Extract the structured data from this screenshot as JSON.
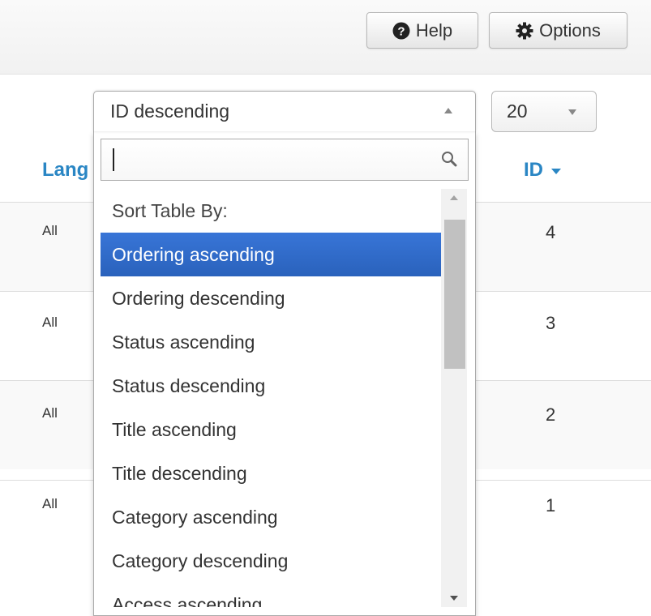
{
  "toolbar": {
    "help_label": "Help",
    "options_label": "Options",
    "help_icon": "question-circle-icon",
    "options_icon": "gear-icon"
  },
  "table": {
    "headers": {
      "language": "Lang",
      "id": "ID"
    },
    "sort_direction_icon": "caret-down-icon",
    "rows": [
      {
        "language": "All",
        "id": "4"
      },
      {
        "language": "All",
        "id": "3"
      },
      {
        "language": "All",
        "id": "2"
      },
      {
        "language": "All",
        "id": "1"
      }
    ]
  },
  "sort": {
    "selected": "ID descending",
    "search_value": "",
    "search_icon": "search-icon",
    "group_label": "Sort Table By:",
    "options": [
      "Ordering ascending",
      "Ordering descending",
      "Status ascending",
      "Status descending",
      "Title ascending",
      "Title descending",
      "Category ascending",
      "Category descending",
      "Access ascending"
    ],
    "highlighted_index": 0
  },
  "limit": {
    "selected": "20"
  },
  "colors": {
    "link": "#2a86c4",
    "highlight": "#3875d7"
  }
}
